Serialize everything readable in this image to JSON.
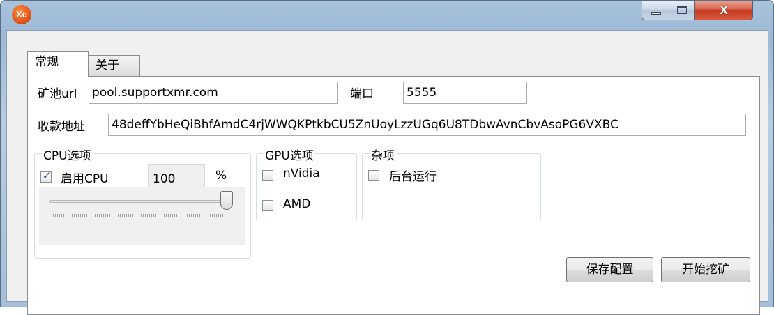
{
  "window": {
    "app_icon_text": "Xc",
    "controls": {
      "close_glyph": "X"
    }
  },
  "tabs": [
    {
      "label": "常规",
      "active": true
    },
    {
      "label": "关于",
      "active": false
    }
  ],
  "general": {
    "pool_url": {
      "label": "矿池url",
      "value": "pool.supportxmr.com"
    },
    "port": {
      "label": "端口",
      "value": "5555"
    },
    "wallet": {
      "label": "收款地址",
      "value": "48deffYbHeQiBhfAmdC4rjWWQKPtkbCU5ZnUoyLzzUGq6U8TDbwAvnCbvAsoPG6VXBC"
    },
    "cpu_group": {
      "title": "CPU选项",
      "enable_cpu": {
        "label": "启用CPU",
        "checked": true
      },
      "usage_value": "100",
      "usage_unit": "%",
      "slider_percent": 100
    },
    "gpu_group": {
      "title": "GPU选项",
      "nvidia": {
        "label": "nVidia",
        "checked": false
      },
      "amd": {
        "label": "AMD",
        "checked": false
      }
    },
    "misc_group": {
      "title": "杂项",
      "background": {
        "label": "后台运行",
        "checked": false
      }
    },
    "buttons": {
      "save": "保存配置",
      "start": "开始挖矿"
    }
  },
  "colors": {
    "frame": "#a9c3dc",
    "close_button": "#c4371c",
    "checkmark": "#2a4a8a"
  }
}
